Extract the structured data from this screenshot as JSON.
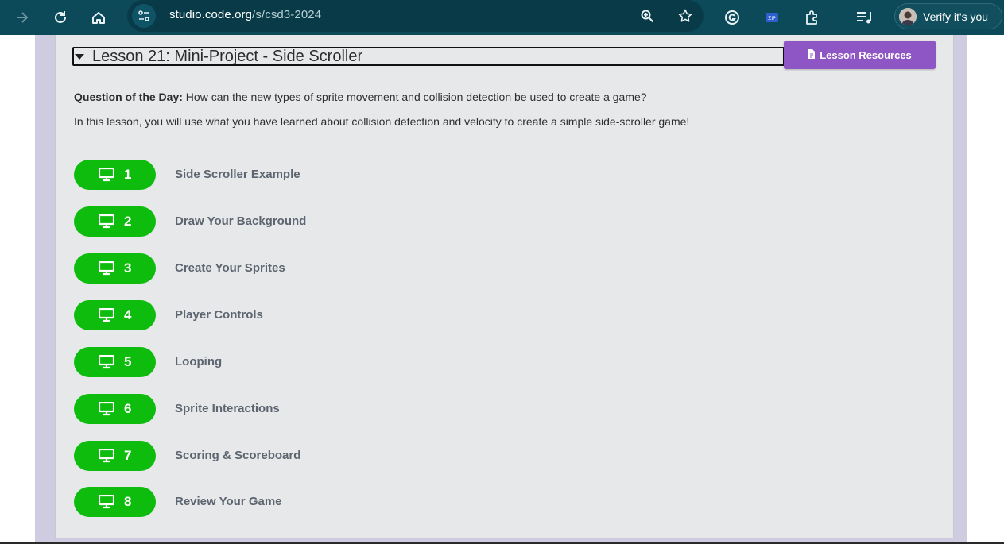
{
  "browser": {
    "url_host": "studio.code.org",
    "url_path": "/s/csd3-2024",
    "profile_label": "Verify it's you",
    "extension_zip_label": "ZIP"
  },
  "lesson": {
    "title": "Lesson 21: Mini-Project - Side Scroller",
    "resources_label": "Lesson Resources",
    "qotd_label": "Question of the Day:",
    "qotd_text": " How can the new types of sprite movement and collision detection be used to create a game?",
    "intro": "In this lesson, you will use what you have learned about collision detection and velocity to create a simple side-scroller game!",
    "levels": [
      {
        "number": "1",
        "name": "Side Scroller Example"
      },
      {
        "number": "2",
        "name": "Draw Your Background"
      },
      {
        "number": "3",
        "name": "Create Your Sprites"
      },
      {
        "number": "4",
        "name": "Player Controls"
      },
      {
        "number": "5",
        "name": "Looping"
      },
      {
        "number": "6",
        "name": "Sprite Interactions"
      },
      {
        "number": "7",
        "name": "Scoring & Scoreboard"
      },
      {
        "number": "8",
        "name": "Review Your Game"
      }
    ]
  },
  "colors": {
    "toolbar": "#0c4a5a",
    "level_pill": "#0ebc0e",
    "resources_button": "#8e55c4",
    "page_background": "#cfcbe0",
    "card_background": "#e7e8ea"
  }
}
